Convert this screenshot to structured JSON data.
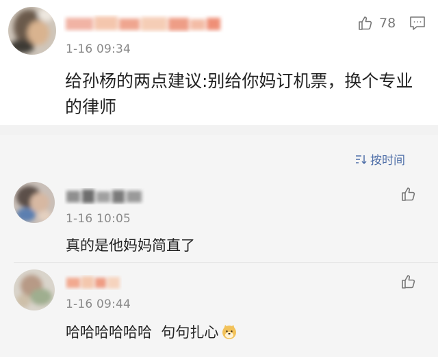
{
  "main_comment": {
    "timestamp": "1-16 09:34",
    "text": "给孙杨的两点建议:别给你妈订机票，换个专业的律师",
    "like_count": "78"
  },
  "replies_header": {
    "sort_label": "按时间"
  },
  "replies": [
    {
      "timestamp": "1-16 10:05",
      "text": "真的是他妈妈简直了"
    },
    {
      "timestamp": "1-16 09:44",
      "text": "哈哈哈哈哈哈  句句扎心"
    }
  ],
  "colors": {
    "link_blue": "#4f6fa8",
    "muted_gray": "#8a8a8a",
    "text_dark": "#222222",
    "background_gray": "#f5f5f5"
  },
  "icons": [
    "thumbs-up-icon",
    "comment-icon",
    "sort-icon",
    "doge-emoji-icon"
  ]
}
